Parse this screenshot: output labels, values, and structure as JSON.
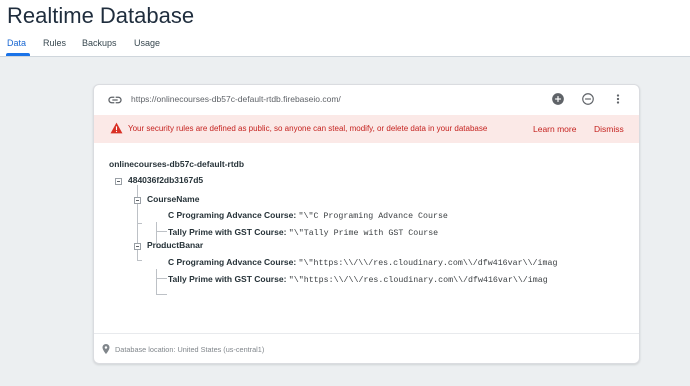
{
  "header": {
    "title": "Realtime Database",
    "tabs": [
      {
        "label": "Data",
        "active": true
      },
      {
        "label": "Rules",
        "active": false
      },
      {
        "label": "Backups",
        "active": false
      },
      {
        "label": "Usage",
        "active": false
      }
    ]
  },
  "card": {
    "url": "https://onlinecourses-db57c-default-rtdb.firebaseio.com/",
    "icons": {
      "link": "link-icon",
      "add": "add-circle-icon",
      "remove": "remove-circle-icon",
      "menu": "more-vert-icon"
    },
    "warning": {
      "text": "Your security rules are defined as public, so anyone can steal, modify, or delete data in your database",
      "learn_more": "Learn more",
      "dismiss": "Dismiss"
    },
    "tree": {
      "root": "onlinecourses-db57c-default-rtdb",
      "child": "484036f2db3167d5",
      "course_name": {
        "key": "CourseName",
        "items": [
          {
            "key": "C Programing Advance Course:",
            "value": "\"\\\"C Programing Advance Course"
          },
          {
            "key": "Tally Prime with GST Course:",
            "value": "\"\\\"Tally Prime with GST Course"
          }
        ]
      },
      "product_banar": {
        "key": "ProductBanar",
        "items": [
          {
            "key": "C Programing Advance Course:",
            "value": "\"\\\"https:\\\\/\\\\/res.cloudinary.com\\\\/dfw416var\\\\/imag"
          },
          {
            "key": "Tally Prime with GST Course:",
            "value": "\"\\\"https:\\\\/\\\\/res.cloudinary.com\\\\/dfw416var\\\\/imag"
          }
        ]
      }
    },
    "footer": "Database location: United States (us-central1)"
  },
  "colors": {
    "accent": "#1a73e8",
    "warning_text": "#c5221f",
    "warning_bg": "#fbe9e7"
  }
}
